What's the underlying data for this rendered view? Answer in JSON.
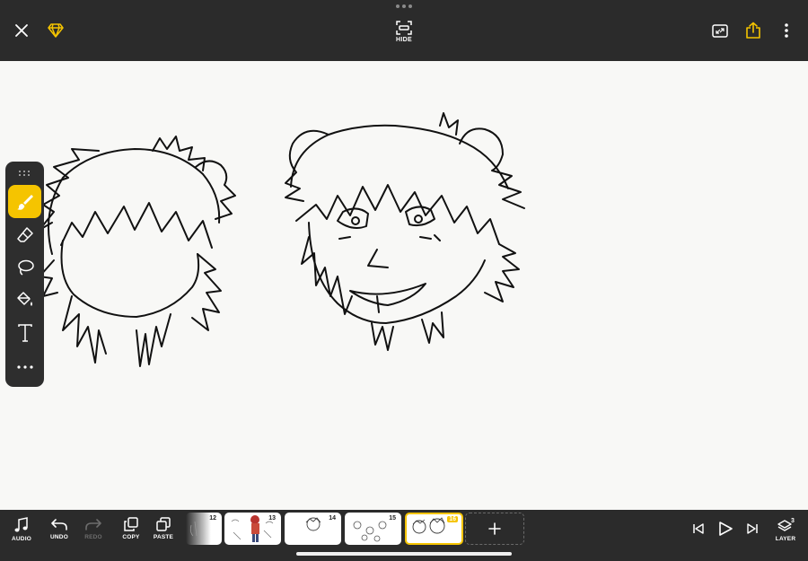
{
  "topbar": {
    "hide_label": "HIDE",
    "icons": [
      "close-icon",
      "diamond-icon",
      "hide-icon",
      "fullscreen-icon",
      "share-icon",
      "more-vertical-icon"
    ]
  },
  "colors": {
    "accent": "#f5c400",
    "bar_background": "#2b2b2b",
    "canvas": "#f8f8f6"
  },
  "palette": {
    "tools": [
      "brush",
      "eraser",
      "lasso",
      "fill",
      "text",
      "more"
    ],
    "active_tool": "brush"
  },
  "bottombar": {
    "audio_label": "AUDIO",
    "undo_label": "UNDO",
    "redo_label": "REDO",
    "copy_label": "COPY",
    "paste_label": "PASTE",
    "layer_label": "LAYER",
    "layer_count": "3",
    "frames": [
      {
        "number": "12",
        "active": false
      },
      {
        "number": "13",
        "active": false
      },
      {
        "number": "14",
        "active": false
      },
      {
        "number": "15",
        "active": false
      },
      {
        "number": "16",
        "active": true
      }
    ],
    "add_frame_symbol": "+"
  }
}
